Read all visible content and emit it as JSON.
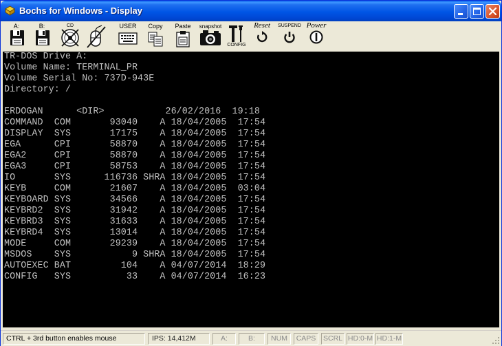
{
  "window": {
    "title": "Bochs for Windows - Display",
    "minimize_label": "",
    "maximize_label": "",
    "close_label": ""
  },
  "toolbar": {
    "floppy_a_label": "A:",
    "floppy_b_label": "B:",
    "cdrom_label": "CD",
    "user_label": "USER",
    "copy_label": "Copy",
    "paste_label": "Paste",
    "snapshot_label": "snapshot",
    "config_label": "CONFIG",
    "reset_label": "Reset",
    "suspend_label": "SUSPEND",
    "power_label": "Power"
  },
  "screen": {
    "lines": [
      "TR-DOS Drive A:",
      "Volume Name: TERMINAL_PR",
      "Volume Serial No: 737D-943E",
      "Directory: /",
      "",
      "ERDOGAN      <DIR>           26/02/2016  19:18",
      "COMMAND  COM       93040    A 18/04/2005  17:54",
      "DISPLAY  SYS       17175    A 18/04/2005  17:54",
      "EGA      CPI       58870    A 18/04/2005  17:54",
      "EGA2     CPI       58870    A 18/04/2005  17:54",
      "EGA3     CPI       58753    A 18/04/2005  17:54",
      "IO       SYS      116736 SHRA 18/04/2005  17:54",
      "KEYB     COM       21607    A 18/04/2005  03:04",
      "KEYBOARD SYS       34566    A 18/04/2005  17:54",
      "KEYBRD2  SYS       31942    A 18/04/2005  17:54",
      "KEYBRD3  SYS       31633    A 18/04/2005  17:54",
      "KEYBRD4  SYS       13014    A 18/04/2005  17:54",
      "MODE     COM       29239    A 18/04/2005  17:54",
      "MSDOS    SYS           9 SHRA 18/04/2005  17:54",
      "AUTOEXEC BAT         104    A 04/07/2014  18:29",
      "CONFIG   SYS          33    A 04/07/2014  16:23"
    ]
  },
  "status": {
    "mouse_hint": "CTRL + 3rd button enables mouse",
    "ips": "IPS: 14,412M",
    "drive_a": "A:",
    "drive_b": "B:",
    "num": "NUM",
    "caps": "CAPS",
    "scrl": "SCRL",
    "hd0": "HD:0-M",
    "hd1": "HD:1-M"
  }
}
